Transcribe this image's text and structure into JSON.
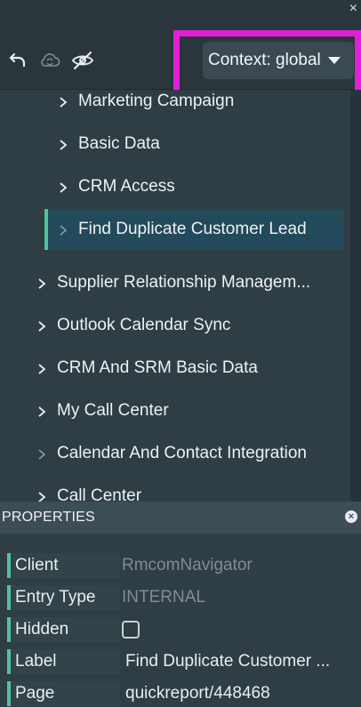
{
  "toolbar": {
    "close_glyph": "×",
    "icons": [
      "undo-icon",
      "cloud-sync-icon",
      "visibility-off-icon"
    ],
    "context_label": "Context: global"
  },
  "tree": {
    "items": [
      {
        "label": "Marketing Campaign",
        "level": 2
      },
      {
        "label": "Basic Data",
        "level": 2
      },
      {
        "label": "CRM Access",
        "level": 2
      },
      {
        "label": "Find Duplicate Customer Lead",
        "level": 2,
        "selected": true
      },
      {
        "label": "Supplier Relationship Managem...",
        "level": 1
      },
      {
        "label": "Outlook Calendar Sync",
        "level": 1
      },
      {
        "label": "CRM And SRM Basic Data",
        "level": 1
      },
      {
        "label": "My Call Center",
        "level": 1
      },
      {
        "label": "Calendar And Contact Integration",
        "level": 1
      },
      {
        "label": "Call Center",
        "level": 1
      }
    ]
  },
  "properties": {
    "title": "PROPERTIES",
    "close_glyph": "×",
    "rows": [
      {
        "key": "Client",
        "value": "RmcomNavigator",
        "muted": true
      },
      {
        "key": "Entry Type",
        "value": "INTERNAL",
        "muted": true
      },
      {
        "key": "Hidden",
        "value": "",
        "checkbox": true
      },
      {
        "key": "Label",
        "value": "Find Duplicate Customer ..."
      },
      {
        "key": "Page",
        "value": "quickreport/448468"
      }
    ]
  },
  "colors": {
    "accent": "#4fc49a",
    "highlight": "#e020d6",
    "selected_bg": "#234a5a"
  }
}
